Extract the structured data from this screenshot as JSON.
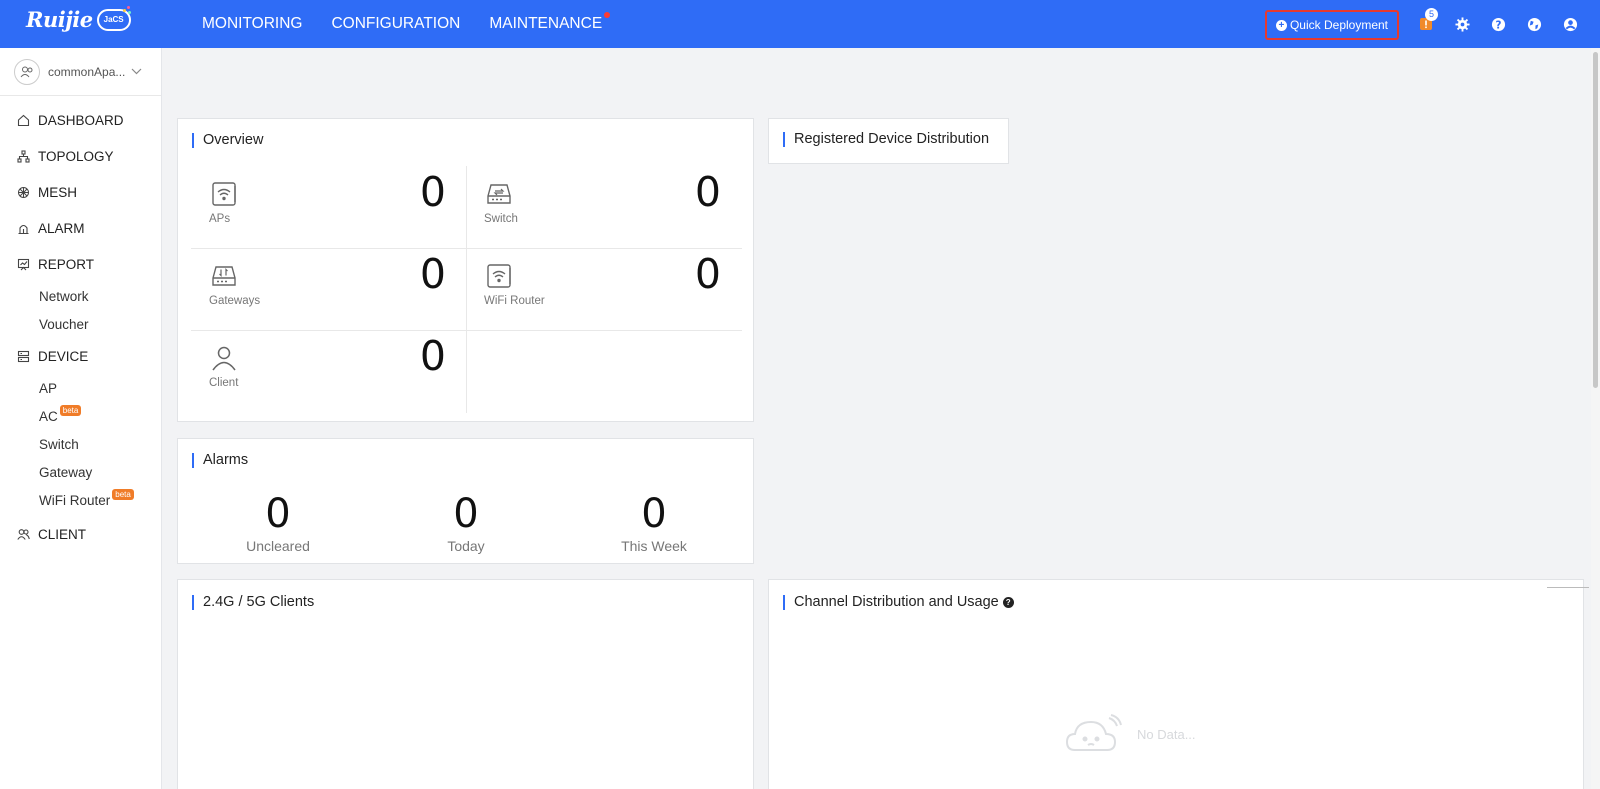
{
  "brand": {
    "logo_text": "Ruijie",
    "logo_badge": "JaCS"
  },
  "nav": [
    {
      "label": "MONITORING"
    },
    {
      "label": "CONFIGURATION"
    },
    {
      "label": "MAINTENANCE"
    }
  ],
  "header": {
    "quick_deploy_label": "Quick Deployment",
    "notification_count": "5"
  },
  "icons": {
    "notification": "notification-icon",
    "settings": "gear-icon",
    "help": "help-icon",
    "language": "globe-icon",
    "user": "user-icon"
  },
  "account": {
    "name": "commonApa..."
  },
  "menu": {
    "dashboard": "DASHBOARD",
    "topology": "TOPOLOGY",
    "mesh": "MESH",
    "alarm": "ALARM",
    "report": "REPORT",
    "report_items": [
      "Network",
      "Voucher"
    ],
    "device": "DEVICE",
    "device_items": [
      "AP",
      "AC",
      "Switch",
      "Gateway",
      "WiFi Router"
    ],
    "beta_label": "beta",
    "client": "CLIENT"
  },
  "overview": {
    "title": "Overview",
    "cells": [
      {
        "label": "APs",
        "value": "0"
      },
      {
        "label": "Switch",
        "value": "0"
      },
      {
        "label": "Gateways",
        "value": "0"
      },
      {
        "label": "WiFi Router",
        "value": "0"
      },
      {
        "label": "Client",
        "value": "0"
      }
    ]
  },
  "registered": {
    "title": "Registered Device Distribution"
  },
  "alarms": {
    "title": "Alarms",
    "items": [
      {
        "label": "Uncleared",
        "value": "0"
      },
      {
        "label": "Today",
        "value": "0"
      },
      {
        "label": "This Week",
        "value": "0"
      }
    ]
  },
  "clients_card": {
    "title": "2.4G / 5G Clients"
  },
  "channel": {
    "title": "Channel Distribution and Usage",
    "help": "?",
    "no_data": "No Data..."
  },
  "colors": {
    "primary": "#2f6cf6",
    "highlight_border": "#e8392f",
    "beta": "#f07c28"
  }
}
